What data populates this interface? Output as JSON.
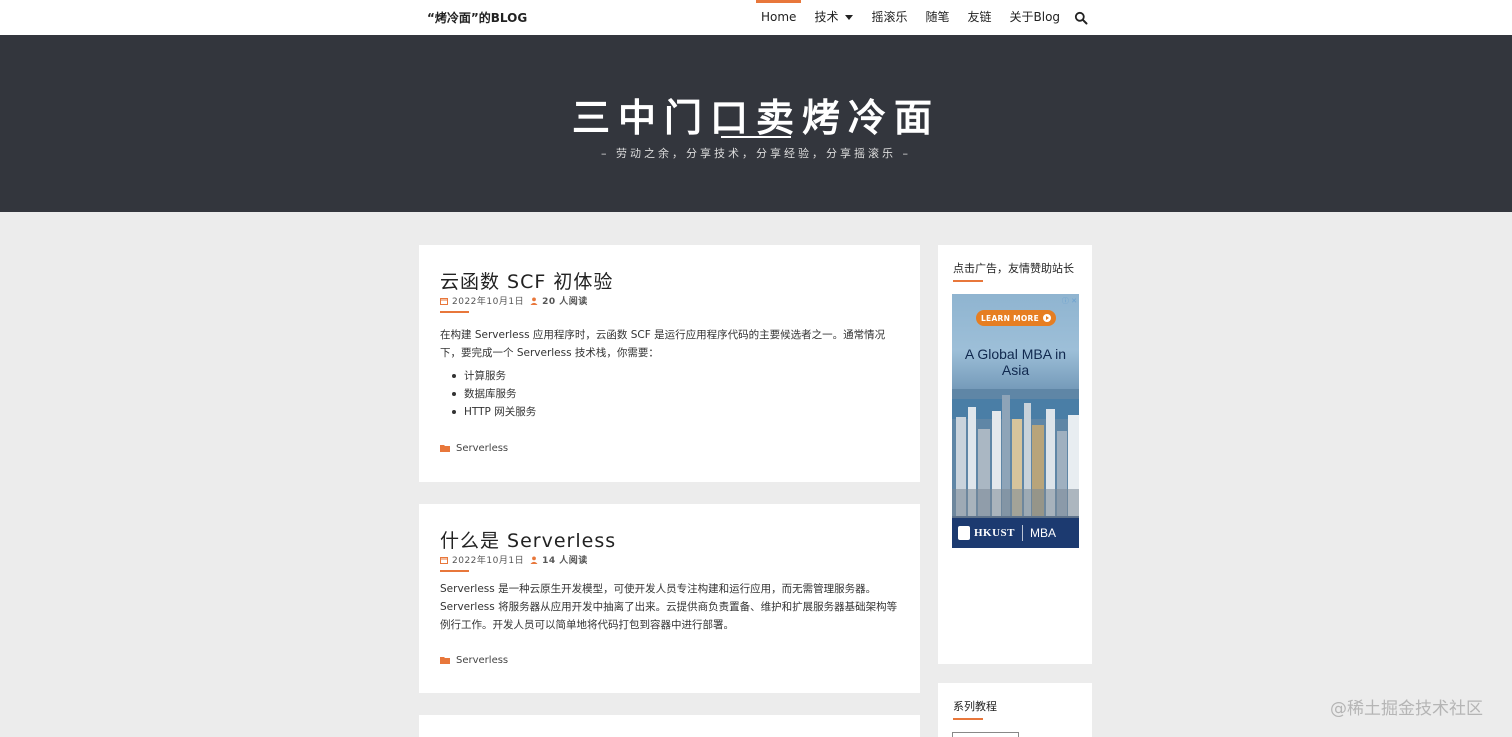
{
  "nav": {
    "brand": "“烤冷面”的BLOG",
    "items": [
      {
        "label": "Home",
        "active": true
      },
      {
        "label": "技术",
        "dropdown": true
      },
      {
        "label": "摇滚乐"
      },
      {
        "label": "随笔"
      },
      {
        "label": "友链"
      },
      {
        "label": "关于Blog"
      }
    ],
    "search_icon": "search-icon"
  },
  "hero": {
    "title": "三中门口卖烤冷面",
    "subtitle": "– 劳动之余，分享技术，分享经验，分享摇滚乐 –"
  },
  "posts": [
    {
      "title": "云函数 SCF 初体验",
      "date": "2022年10月1日",
      "views": "20 人阅读",
      "body": "在构建 Serverless 应用程序时，云函数 SCF 是运行应用程序代码的主要候选者之一。通常情况下，要完成一个 Serverless 技术栈，你需要：",
      "list": [
        "计算服务",
        "数据库服务",
        "HTTP 网关服务"
      ],
      "category": "Serverless"
    },
    {
      "title": "什么是 Serverless",
      "date": "2022年10月1日",
      "views": "14 人阅读",
      "body": "Serverless 是一种云原生开发模型，可使开发人员专注构建和运行应用，而无需管理服务器。Serverless 将服务器从应用开发中抽离了出来。云提供商负责置备、维护和扩展服务器基础架构等例行工作。开发人员可以简单地将代码打包到容器中进行部署。",
      "category": "Serverless"
    }
  ],
  "sidebar": {
    "ad_widget_title": "点击广告，友情赞助站长",
    "ad": {
      "button": "LEARN MORE",
      "headline": "A Global MBA in Asia",
      "brand": "HKUST",
      "program": "MBA",
      "choices": "ⓘ ✕"
    },
    "series_title": "系列教程"
  },
  "watermark": "@稀土掘金技术社区",
  "colors": {
    "accent": "#e8773b",
    "hero_bg": "#33363d",
    "page_bg": "#ececec"
  }
}
